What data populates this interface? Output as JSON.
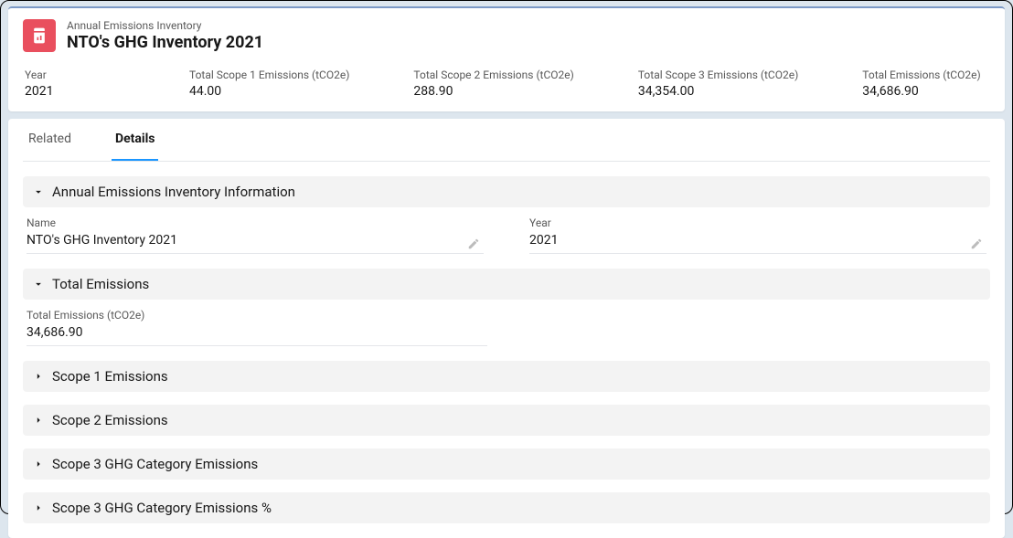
{
  "header": {
    "object_type": "Annual Emissions Inventory",
    "title": "NTO's GHG Inventory 2021"
  },
  "highlights": [
    {
      "label": "Year",
      "value": "2021"
    },
    {
      "label": "Total Scope 1 Emissions (tCO2e)",
      "value": "44.00"
    },
    {
      "label": "Total Scope 2 Emissions (tCO2e)",
      "value": "288.90"
    },
    {
      "label": "Total Scope 3 Emissions (tCO2e)",
      "value": "34,354.00"
    },
    {
      "label": "Total Emissions (tCO2e)",
      "value": "34,686.90"
    }
  ],
  "tabs": {
    "related": "Related",
    "details": "Details"
  },
  "sections": {
    "info": {
      "title": "Annual Emissions Inventory Information",
      "name_label": "Name",
      "name_value": "NTO's GHG Inventory 2021",
      "year_label": "Year",
      "year_value": "2021"
    },
    "total": {
      "title": "Total Emissions",
      "te_label": "Total Emissions (tCO2e)",
      "te_value": "34,686.90"
    },
    "scope1": {
      "title": "Scope 1 Emissions"
    },
    "scope2": {
      "title": "Scope 2 Emissions"
    },
    "scope3cat": {
      "title": "Scope 3 GHG Category Emissions"
    },
    "scope3pct": {
      "title": "Scope 3 GHG Category Emissions %"
    }
  }
}
